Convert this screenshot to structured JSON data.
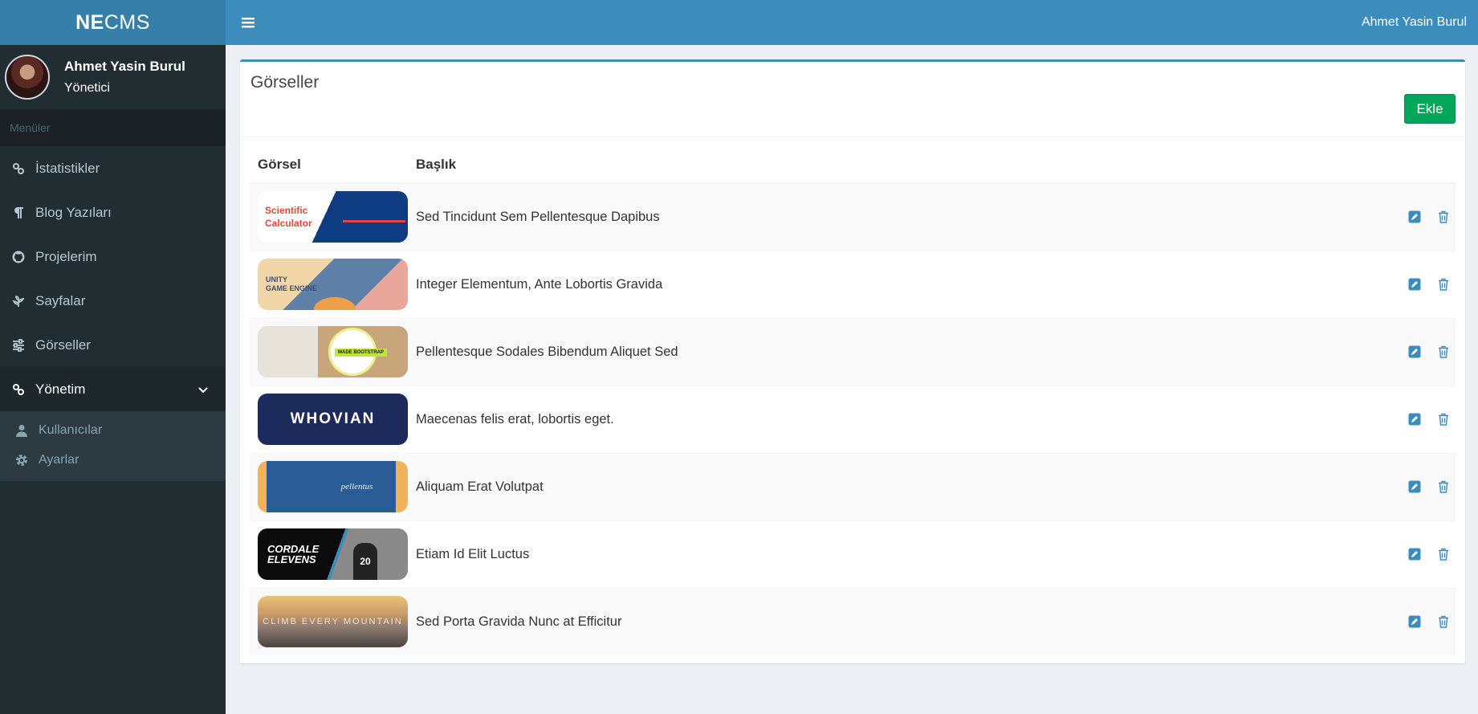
{
  "brand": {
    "bold": "NE",
    "rest": "CMS"
  },
  "user": {
    "name": "Ahmet Yasin Burul",
    "role": "Yönetici"
  },
  "sidebar": {
    "header": "Menüler",
    "items": [
      {
        "label": "İstatistikler",
        "icon": "link-icon"
      },
      {
        "label": "Blog Yazıları",
        "icon": "paragraph-icon"
      },
      {
        "label": "Projelerim",
        "icon": "github-icon"
      },
      {
        "label": "Sayfalar",
        "icon": "pagelines-icon"
      },
      {
        "label": "Görseller",
        "icon": "sliders-icon"
      },
      {
        "label": "Yönetim",
        "icon": "link-icon",
        "expanded": true
      }
    ],
    "subitems": [
      {
        "label": "Kullanıcılar",
        "icon": "user-icon"
      },
      {
        "label": "Ayarlar",
        "icon": "gear-icon"
      }
    ]
  },
  "navbar": {
    "user": "Ahmet Yasin Burul"
  },
  "page": {
    "title": "Görseller",
    "add_label": "Ekle",
    "columns": {
      "image": "Görsel",
      "title": "Başlık"
    },
    "rows": [
      {
        "title": "Sed Tincidunt Sem Pellentesque Dapibus"
      },
      {
        "title": "Integer Elementum, Ante Lobortis Gravida"
      },
      {
        "title": "Pellentesque Sodales Bibendum Aliquet Sed"
      },
      {
        "title": "Maecenas felis erat, lobortis eget."
      },
      {
        "title": "Aliquam Erat Volutpat"
      },
      {
        "title": "Etiam Id Elit Luctus"
      },
      {
        "title": "Sed Porta Gravida Nunc at Efficitur"
      }
    ]
  },
  "thumbnails": {
    "t1": {
      "line1": "Scientific",
      "line2": "Calculator"
    },
    "t2": {
      "line1": "UNITY",
      "line2": "GAME ENGINE"
    },
    "t3": {
      "label": "MADE BOOTSTRAP"
    },
    "t4": {
      "text": "WHOVIAN"
    },
    "t5": {
      "text": "pellentus"
    },
    "t6": {
      "line1": "CORDALE",
      "line2": "ELEVENS",
      "number": "20"
    },
    "t7": {
      "text": "CLIMB EVERY MOUNTAIN"
    }
  },
  "colors": {
    "sidebar_bg": "#222d32",
    "navbar_bg": "#3c8dbc",
    "logo_bg": "#367fa9",
    "add_button": "#00a65a",
    "action_icon": "#3c8dbc"
  }
}
